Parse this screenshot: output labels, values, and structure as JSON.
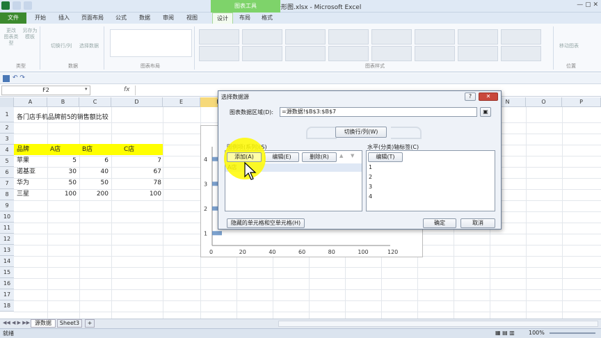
{
  "window": {
    "title": "11.多图例的条形图.xlsx - Microsoft Excel",
    "context_tab_group": "图表工具"
  },
  "tabs": [
    "文件",
    "开始",
    "插入",
    "页面布局",
    "公式",
    "数据",
    "审阅",
    "视图",
    "设计",
    "布局",
    "格式"
  ],
  "ribbon": {
    "groups": {
      "type": {
        "label": "类型",
        "buttons": [
          "更改\n图表类型",
          "另存为\n模板"
        ]
      },
      "data": {
        "label": "数据",
        "buttons": [
          "切换行/列",
          "选择数据"
        ]
      },
      "layout": {
        "label": "图表布局"
      },
      "styles": {
        "label": "图表样式"
      },
      "location": {
        "label": "位置",
        "buttons": [
          "移动图表"
        ]
      }
    }
  },
  "formula_bar": {
    "name_box": "F2",
    "fx": "fx",
    "formula": ""
  },
  "sheet": {
    "columns": [
      "A",
      "B",
      "C",
      "D",
      "E",
      "F",
      "G",
      "H",
      "I",
      "J",
      "K",
      "L",
      "M",
      "N",
      "O",
      "P"
    ],
    "rows": [
      "1",
      "2",
      "3",
      "4",
      "5",
      "6",
      "7",
      "8",
      "9",
      "10",
      "11",
      "12",
      "13",
      "14",
      "15",
      "16",
      "17",
      "18"
    ],
    "title_cell": "各门店手机品牌前5的销售额比较",
    "header": [
      "品牌",
      "A店",
      "B店",
      "C店"
    ],
    "data": [
      [
        "苹果",
        "5",
        "6",
        "7"
      ],
      [
        "诺基亚",
        "30",
        "40",
        "67"
      ],
      [
        "华为",
        "50",
        "50",
        "78"
      ],
      [
        "三星",
        "100",
        "200",
        "100"
      ]
    ],
    "header_fill": "#ffff00"
  },
  "chart_data": {
    "type": "bar",
    "categories": [
      "1",
      "2",
      "3",
      "4"
    ],
    "x_ticks": [
      "0",
      "20",
      "40",
      "60",
      "80",
      "100",
      "120"
    ],
    "xlim": [
      0,
      120
    ],
    "title": "",
    "series_color": "#4f81bd"
  },
  "dialog": {
    "title": "选择数据源",
    "range_label": "图表数据区域(D):",
    "range_value": "=源数据!$B$3:$B$7",
    "switch_button": "切换行/列(W)",
    "legend_label": "图例项(系列)(S)",
    "add_button": "添加(A)",
    "edit_button": "编辑(E)",
    "delete_button": "删除(R)",
    "series_items": [
      "A店"
    ],
    "axis_label": "水平(分类)轴标签(C)",
    "axis_edit_button": "编辑(T)",
    "axis_items": [
      "1",
      "2",
      "3",
      "4"
    ],
    "hidden_cells_button": "隐藏的单元格和空单元格(H)",
    "ok_button": "确定",
    "cancel_button": "取消",
    "help_icon": "?"
  },
  "sheet_tabs": [
    "源数据",
    "Sheet3"
  ],
  "status": {
    "left": "就绪",
    "zoom": "100%"
  }
}
